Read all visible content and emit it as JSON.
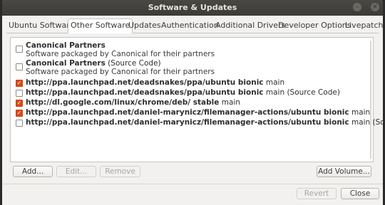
{
  "window": {
    "title": "Software & Updates"
  },
  "tabs": [
    {
      "label": "Ubuntu Software"
    },
    {
      "label": "Other Software"
    },
    {
      "label": "Updates"
    },
    {
      "label": "Authentication"
    },
    {
      "label": "Additional Drivers"
    },
    {
      "label": "Developer Options"
    },
    {
      "label": "Livepatch"
    }
  ],
  "sources": [
    {
      "title_bold": "Canonical Partners",
      "title_rest": "",
      "subtitle": "Software packaged by Canonical for their partners",
      "checked": false
    },
    {
      "title_bold": "Canonical Partners",
      "title_rest": " (Source Code)",
      "subtitle": "Software packaged by Canonical for their partners",
      "checked": false
    },
    {
      "title_bold": "http://ppa.launchpad.net/deadsnakes/ppa/ubuntu bionic",
      "title_rest": " main",
      "subtitle": "",
      "checked": true
    },
    {
      "title_bold": "http://ppa.launchpad.net/deadsnakes/ppa/ubuntu bionic",
      "title_rest": " main (Source Code)",
      "subtitle": "",
      "checked": false
    },
    {
      "title_bold": "http://dl.google.com/linux/chrome/deb/ stable",
      "title_rest": " main",
      "subtitle": "",
      "checked": true
    },
    {
      "title_bold": "http://ppa.launchpad.net/daniel-marynicz/filemanager-actions/ubuntu bionic",
      "title_rest": " main",
      "subtitle": "",
      "checked": true
    },
    {
      "title_bold": "http://ppa.launchpad.net/daniel-marynicz/filemanager-actions/ubuntu bionic",
      "title_rest": " main (Source Code)",
      "subtitle": "",
      "checked": false
    }
  ],
  "buttons": {
    "add": "Add...",
    "edit": "Edit...",
    "remove": "Remove",
    "add_volume": "Add Volume...",
    "revert": "Revert",
    "close": "Close"
  },
  "colors": {
    "checkbox_checked": "#df4a16",
    "titlebar": "#3c3b37"
  },
  "icons": {
    "minimize": "minimize-icon",
    "close": "close-icon"
  }
}
